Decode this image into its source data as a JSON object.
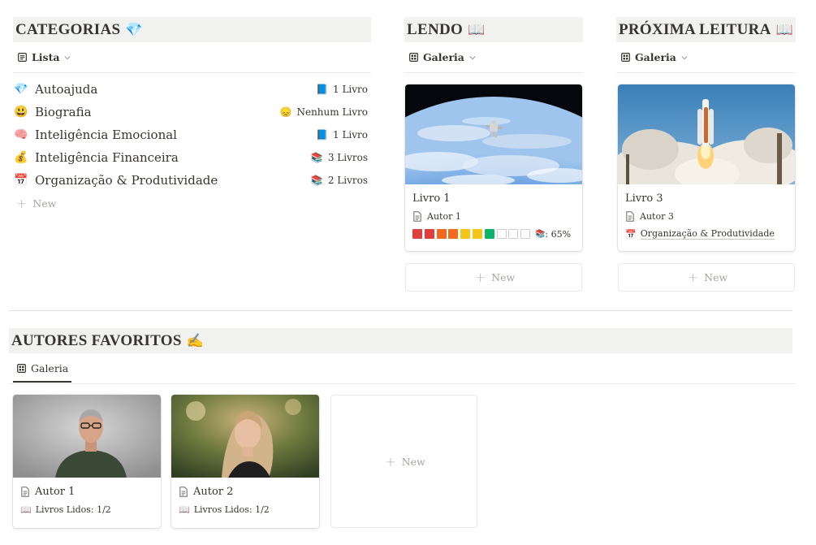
{
  "categorias": {
    "title": "CATEGORIAS",
    "title_emoji": "💎",
    "view_label": "Lista",
    "items": [
      {
        "emoji": "💎",
        "name": "Autoajuda",
        "count_icon": "📘",
        "count": "1 Livro"
      },
      {
        "emoji": "😃",
        "name": "Biografia",
        "count_icon": "😞",
        "count": "Nenhum Livro"
      },
      {
        "emoji": "🧠",
        "name": "Inteligência Emocional",
        "count_icon": "📘",
        "count": "1 Livro"
      },
      {
        "emoji": "💰",
        "name": "Inteligência Financeira",
        "count_icon": "📚",
        "count": "3 Livros"
      },
      {
        "emoji": "📅",
        "name": "Organização & Produtividade",
        "count_icon": "📚",
        "count": "2 Livros"
      }
    ],
    "new_label": "New"
  },
  "lendo": {
    "title": "LENDO",
    "title_emoji": "📖",
    "view_label": "Galeria",
    "card": {
      "title": "Livro 1",
      "author": "Autor 1",
      "progress_colors": [
        "#e03e3e",
        "#e03e3e",
        "#f06a22",
        "#f06a22",
        "#f5c518",
        "#f5c518",
        "#0fb36a"
      ],
      "progress_empty": 3,
      "progress_icon": "📚",
      "progress_text": ": 65%"
    },
    "new_label": "New"
  },
  "proxima": {
    "title": "PRÓXIMA LEITURA",
    "title_emoji": "📖",
    "view_label": "Galeria",
    "card": {
      "title": "Livro 3",
      "author": "Autor 3",
      "category_emoji": "📅",
      "category": "Organização & Produtividade"
    },
    "new_label": "New"
  },
  "autores": {
    "title": "AUTORES FAVORITOS",
    "title_emoji": "✍️",
    "view_label": "Galeria",
    "cards": [
      {
        "name": "Autor 1",
        "books_emoji": "📖",
        "books": "Livros Lidos: 1/2"
      },
      {
        "name": "Autor 2",
        "books_emoji": "📖",
        "books": "Livros Lidos: 1/2"
      }
    ],
    "new_label": "New"
  }
}
